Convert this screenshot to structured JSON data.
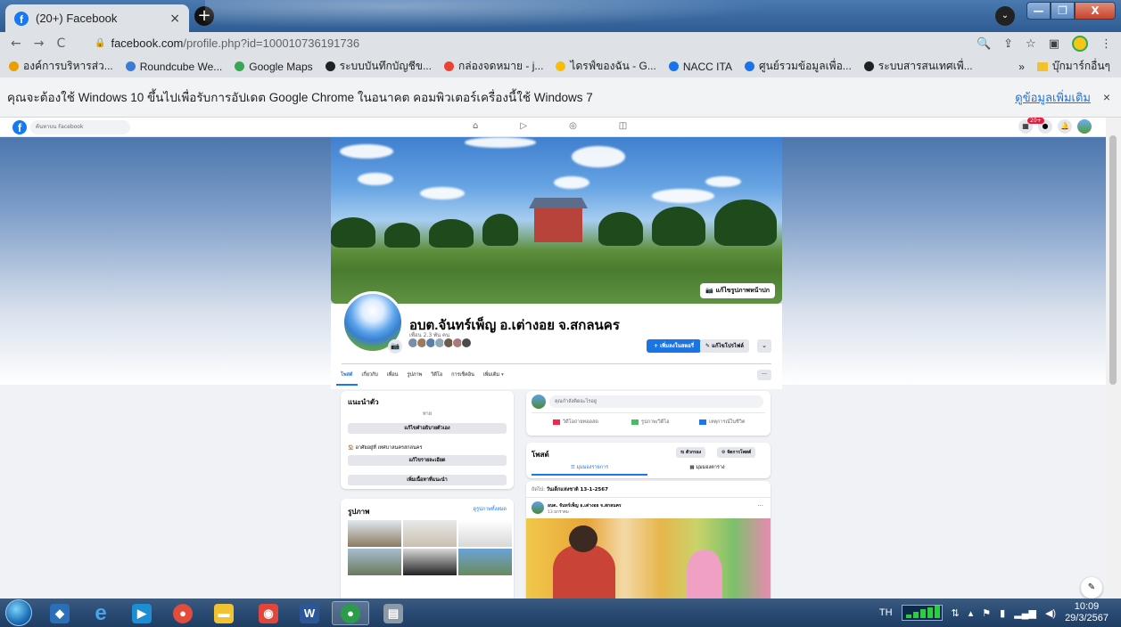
{
  "tab": {
    "title": "(20+) Facebook",
    "close": "×"
  },
  "newtab": "+",
  "window": {
    "minimize": "—",
    "maximize": "❐",
    "close": "X"
  },
  "toolbar": {
    "back": "←",
    "forward": "→",
    "reload": "C",
    "url_host": "facebook.com",
    "url_path": "/profile.php?id=100010736191736"
  },
  "bookmarks": [
    {
      "label": "องค์การบริหารส่ว...",
      "color": "#e8a000"
    },
    {
      "label": "Roundcube We...",
      "color": "#3a7bd5"
    },
    {
      "label": "Google Maps",
      "color": "#34a853"
    },
    {
      "label": "ระบบบันทึกบัญชีข...",
      "color": "#202124"
    },
    {
      "label": "กล่องจดหมาย - j...",
      "color": "#ea4335"
    },
    {
      "label": "ไดรฟ์ของฉัน - G...",
      "color": "#fbbc05"
    },
    {
      "label": "NACC ITA",
      "color": "#1a73e8"
    },
    {
      "label": "ศูนย์รวมข้อมูลเพื่อ...",
      "color": "#1a73e8"
    },
    {
      "label": "ระบบสารสนเทศเพื่...",
      "color": "#202124"
    }
  ],
  "bookmarks_more": "»",
  "bookmarks_other": "บุ๊กมาร์กอื่นๆ",
  "infobar": {
    "message": "คุณจะต้องใช้ Windows 10 ขึ้นไปเพื่อรับการอัปเดต Google Chrome ในอนาคต คอมพิวเตอร์เครื่องนี้ใช้ Windows 7",
    "learn_more": "ดูข้อมูลเพิ่มเติม",
    "close": "×"
  },
  "fb": {
    "search_placeholder": "ค้นหาบน Facebook",
    "notif_badge": "20+",
    "edit_cover": "แก้ไขรูปภาพหน้าปก",
    "profile_name": "อบต.จันทร์เพ็ญ อ.เต่างอย จ.สกลนคร",
    "friends": "เพื่อน 2.3 พัน คน",
    "add_story": "+ เพิ่มลงในสตอรี่",
    "edit_profile": "แก้ไขโปรไฟล์",
    "tabs": [
      "โพสต์",
      "เกี่ยวกับ",
      "เพื่อน",
      "รูปภาพ",
      "วิดีโอ",
      "การเช็คอิน",
      "เพิ่มเติม ▾"
    ],
    "tabs_more": "···",
    "intro": {
      "title": "แนะนำตัว",
      "bio": "ทาย",
      "edit_bio": "แก้ไขคำอธิบายตัวเอง",
      "location": "อาศัยอยู่ที่ เทศบาลนครสกลนคร",
      "edit_details": "แก้ไขรายละเอียด",
      "add_featured": "เพิ่มเนื้อหาที่แนะนำ"
    },
    "photos": {
      "title": "รูปภาพ",
      "see_all": "ดูรูปภาพทั้งหมด"
    },
    "composer": {
      "placeholder": "คุณกำลังคิดอะไรอยู่",
      "live": "วิดีโอถ่ายทอดสด",
      "photo": "รูปภาพ/วิดีโอ",
      "event": "เหตุการณ์ในชีวิต"
    },
    "posts": {
      "title": "โพสต์",
      "filter": "ตัวกรอง",
      "manage": "จัดการโพสต์",
      "list_view": "มุมมองรายการ",
      "grid_view": "มุมมองตาราง"
    },
    "feed": {
      "header_prefix": "ถัดไป:",
      "header_event": "วันเด็กแห่งชาติ 13-1-2567",
      "author": "อบต. จันทร์เพ็ญ อ.เต่างอย จ.สกลนคร",
      "date": "13 มกราคม ·",
      "more": "···"
    }
  },
  "taskbar": {
    "lang": "TH",
    "time": "10:09",
    "date": "29/3/2567"
  }
}
